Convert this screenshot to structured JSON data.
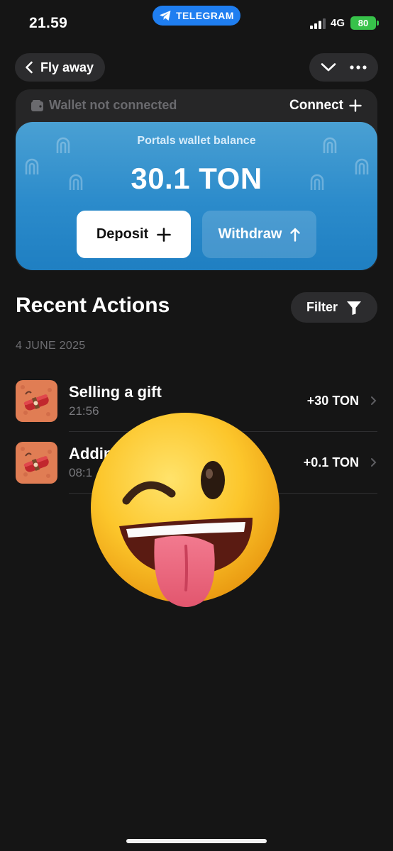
{
  "status_bar": {
    "time": "21.59",
    "telegram_label": "TELEGRAM",
    "network": "4G",
    "battery": "80"
  },
  "nav": {
    "back_label": "Fly away",
    "icons": [
      "chevron-left-icon",
      "chevron-down-icon",
      "more-icon"
    ]
  },
  "wallet": {
    "status_text": "Wallet not connected",
    "connect_label": "Connect",
    "balance_label": "Portals wallet balance",
    "balance_value": "30.1 TON",
    "deposit_label": "Deposit",
    "withdraw_label": "Withdraw"
  },
  "recent": {
    "title": "Recent Actions",
    "filter_label": "Filter",
    "date_group": "4 JUNE 2025",
    "items": [
      {
        "title": "Selling a gift",
        "time": "21:56",
        "amount": "+30 TON"
      },
      {
        "title": "Addin",
        "time": "08:1",
        "amount": "+0.1 TON"
      }
    ]
  },
  "colors": {
    "background": "#151515",
    "surface": "#2c2c2e",
    "balance_blue": "#2b8bcb",
    "telegram_blue": "#1f7ef0",
    "battery_green": "#37c24a"
  }
}
